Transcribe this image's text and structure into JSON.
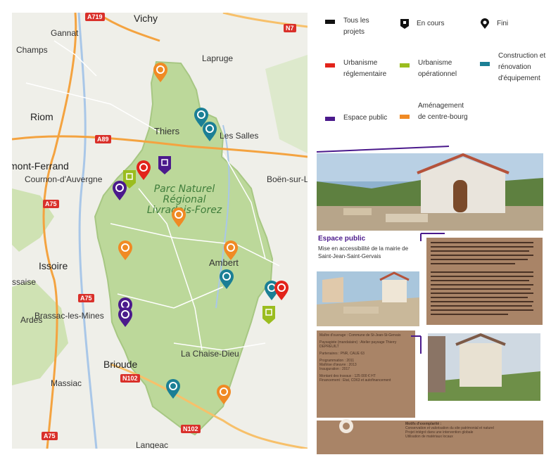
{
  "map": {
    "towns": [
      {
        "label": "Vichy"
      },
      {
        "label": "Gannat"
      },
      {
        "label": "Champs"
      },
      {
        "label": "Lapruge"
      },
      {
        "label": "Riom"
      },
      {
        "label": "Thiers"
      },
      {
        "label": "Les Salles"
      },
      {
        "label": "mont-Ferrand"
      },
      {
        "label": "Cournon-d'Auvergne"
      },
      {
        "label": "Boën-sur-L"
      },
      {
        "label": "Issoire"
      },
      {
        "label": "Ambert"
      },
      {
        "label": "ssaise"
      },
      {
        "label": "Brassac-les-Mines"
      },
      {
        "label": "Ardes"
      },
      {
        "label": "Brioude"
      },
      {
        "label": "La Chaise-Dieu"
      },
      {
        "label": "Massiac"
      },
      {
        "label": "Langeac"
      }
    ],
    "park_label": "Parc Naturel Régional Livradois-Forez",
    "roads": [
      "A719",
      "N7",
      "A89",
      "A75",
      "A75",
      "N102",
      "N102",
      "A75"
    ]
  },
  "legend": {
    "all_projects": "Tous les projets",
    "in_progress": "En cours",
    "finished": "Fini",
    "urbanisme_reglementaire": "Urbanisme réglementaire",
    "urbanisme_operationnel": "Urbanisme opérationnel",
    "construction": "Construction et rénovation d'équipement",
    "espace_public": "Espace public",
    "amenagement": "Aménagement de centre-bourg",
    "colors": {
      "black": "#111111",
      "red": "#e2231a",
      "green": "#9bbd1f",
      "teal": "#1b7f95",
      "purple": "#4b1a8c",
      "orange": "#f08a24"
    }
  },
  "panel": {
    "category": "Espace public",
    "title": "Mise en accessibilité de la mairie de Saint-Jean-Saint-Gervais",
    "info_lines": [
      "Maître d'ouvrage : Commune de St-Jean-St-Gervais",
      "Paysagiste (mandataire) : Atelier paysage Thierry DEPREUILT",
      "Partenaires : PNR, CAUE 63",
      "Programmation : 2011",
      "Maîtrise d'œuvre : 2013",
      "Inauguration : 2017",
      "Montant des travaux : 125 000 € HT",
      "Financement : Etat, CD63 et autofinancement"
    ],
    "footer_title": "Motifs d'exemplarité :",
    "footer_items": [
      "Conservation et valorisation du site patrimonial et naturel",
      "Projet intégré dans une intervention globale",
      "Utilisation de matériaux locaux"
    ]
  }
}
